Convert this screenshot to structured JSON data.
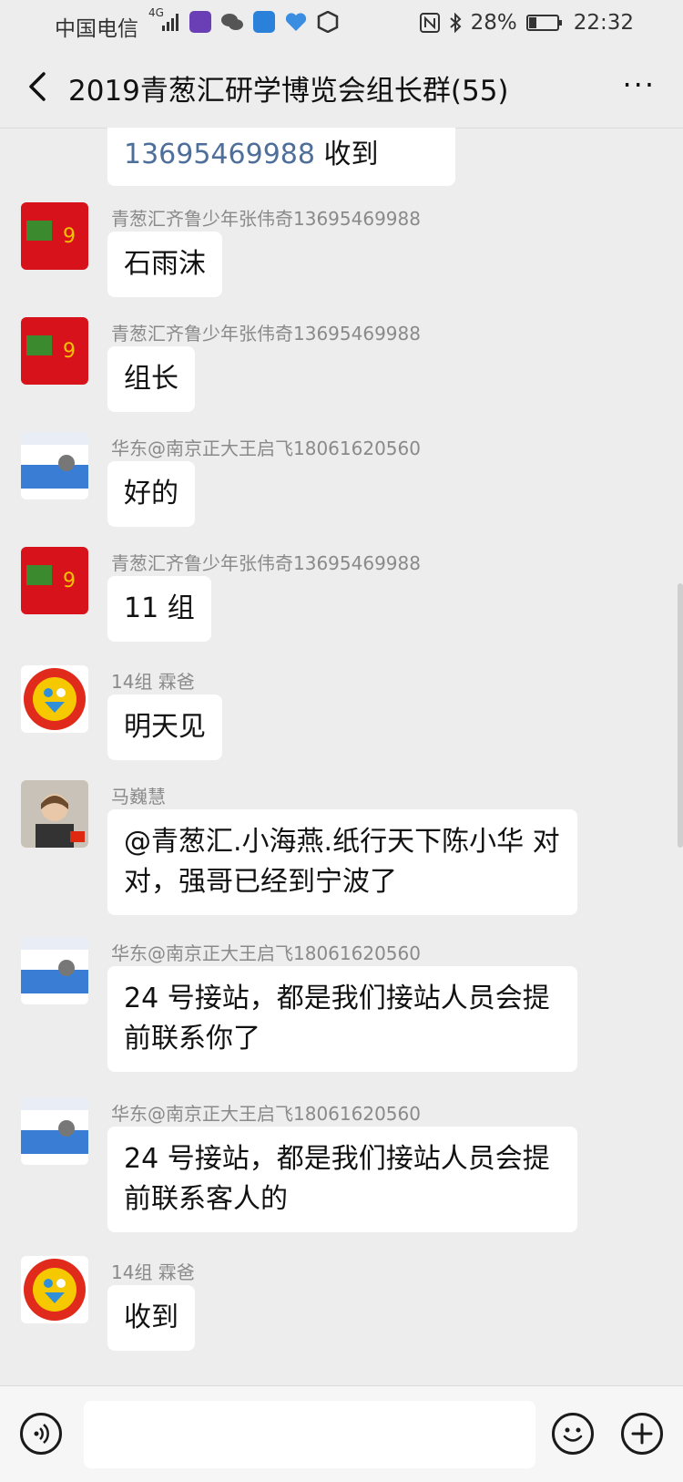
{
  "status_bar": {
    "carrier": "中国电信",
    "network": "4G",
    "battery": "28%",
    "time": "22:32",
    "icons": [
      "signal-icon",
      "novel-app-icon",
      "wechat-icon",
      "browser-icon",
      "heart-app-icon",
      "hexagon-app-icon",
      "nfc-icon",
      "bluetooth-icon",
      "battery-icon"
    ]
  },
  "header": {
    "title": "2019青葱汇研学博览会组长群(55)",
    "back_icon": "chevron-left-icon",
    "more_icon": "more-dots-icon",
    "more_label": "···"
  },
  "messages": [
    {
      "sender": "",
      "text_prefix": "13695469988",
      "text": " 收到",
      "avatar": ""
    },
    {
      "sender": "青葱汇齐鲁少年张伟奇13695469988",
      "text": "石雨沫",
      "avatar": "red-card-avatar"
    },
    {
      "sender": "青葱汇齐鲁少年张伟奇13695469988",
      "text": "组长",
      "avatar": "red-card-avatar"
    },
    {
      "sender": "华东@南京正大王启飞18061620560",
      "text": "好的",
      "avatar": "business-card-avatar"
    },
    {
      "sender": "青葱汇齐鲁少年张伟奇13695469988",
      "text": "11 组",
      "avatar": "red-card-avatar"
    },
    {
      "sender": "14组  霖爸",
      "text": "明天见",
      "avatar": "circle-logo-avatar"
    },
    {
      "sender": "马巍慧",
      "text": "@青葱汇.小海燕.纸行天下陈小华 对对，强哥已经到宁波了",
      "avatar": "photo-avatar"
    },
    {
      "sender": "华东@南京正大王启飞18061620560",
      "text": "24 号接站，都是我们接站人员会提前联系你了",
      "avatar": "business-card-avatar"
    },
    {
      "sender": "华东@南京正大王启飞18061620560",
      "text": "24 号接站，都是我们接站人员会提前联系客人的",
      "avatar": "business-card-avatar"
    },
    {
      "sender": "14组  霖爸",
      "text": "收到",
      "avatar": "circle-logo-avatar"
    }
  ],
  "input_bar": {
    "voice_icon": "voice-icon",
    "emoji_icon": "emoji-icon",
    "plus_icon": "plus-icon",
    "placeholder": ""
  },
  "colors": {
    "background": "#ededed",
    "bubble": "#ffffff",
    "mention": "#4d6f9a",
    "sender": "#8a8a8a"
  }
}
